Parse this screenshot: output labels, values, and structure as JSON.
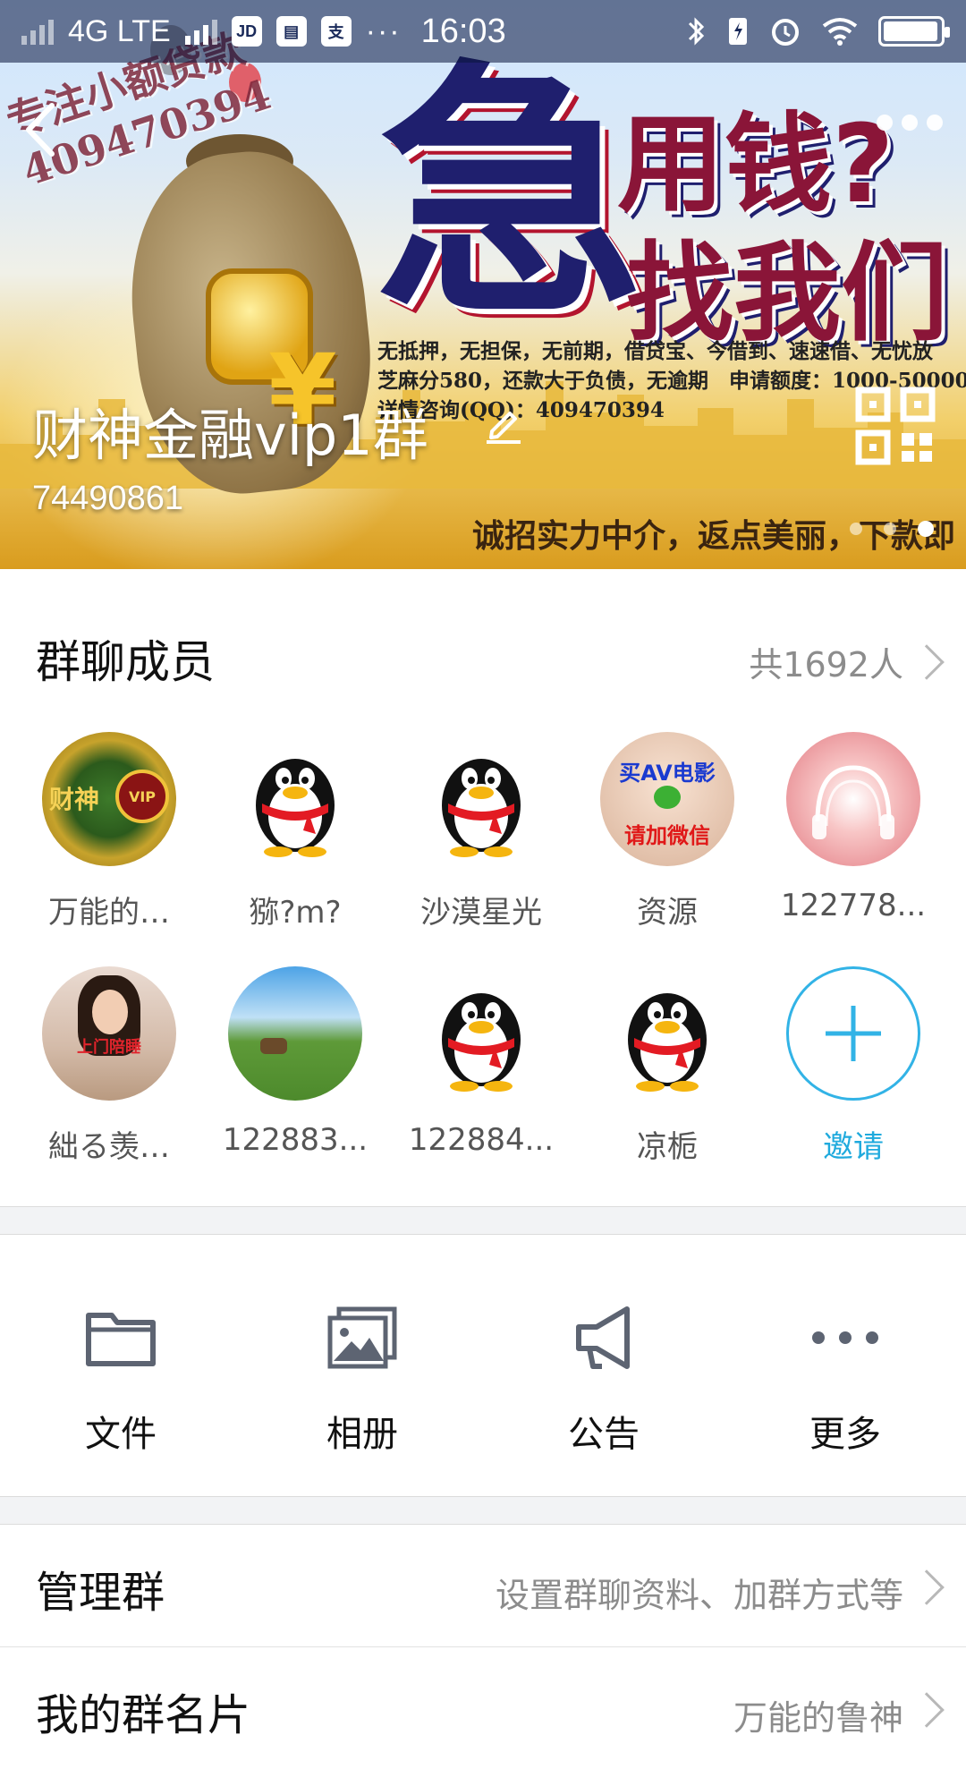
{
  "status_bar": {
    "network": "4G LTE",
    "app_icons": [
      "JD",
      "▤",
      "支"
    ],
    "more": "···",
    "time": "16:03"
  },
  "banner": {
    "watermark": "专注小额贷款 409470394",
    "headline_big": "急",
    "headline_line1": "用钱?",
    "headline_line2": "找我们",
    "copy_line1": "无抵押，无担保，无前期，借贷宝、今借到、速速借、无忧放",
    "copy_line2": "芝麻分580，还款大于负债，无逾期　申请额度：1000-50000",
    "copy_line3": "详情咨询(QQ)：409470394",
    "recruit_text": "诚招实力中介，返点美丽，下款即",
    "carousel_total": 3,
    "carousel_active": 3
  },
  "group": {
    "name": "财神金融vip1群",
    "id": "74490861"
  },
  "members": {
    "title": "群聊成员",
    "count_label": "共1692人",
    "items": [
      {
        "name": "万能的…",
        "avatar": "caishen-vip"
      },
      {
        "name": "猕?m?",
        "avatar": "qq-penguin"
      },
      {
        "name": "沙漠星光",
        "avatar": "qq-penguin"
      },
      {
        "name": "资源",
        "avatar": "ad-image",
        "line1": "买AV电影",
        "line2": "请加微信"
      },
      {
        "name": "122778...",
        "avatar": "pink-headphone"
      },
      {
        "name": "絀る羡…",
        "avatar": "woman-photo",
        "tag": "上门陪睡"
      },
      {
        "name": "122883...",
        "avatar": "field-photo"
      },
      {
        "name": "122884...",
        "avatar": "qq-penguin"
      },
      {
        "name": "凉栀",
        "avatar": "qq-penguin"
      }
    ],
    "invite_label": "邀请"
  },
  "actions": [
    {
      "label": "文件",
      "icon": "folder-icon"
    },
    {
      "label": "相册",
      "icon": "album-icon"
    },
    {
      "label": "公告",
      "icon": "megaphone-icon"
    },
    {
      "label": "更多",
      "icon": "more-dots-icon"
    }
  ],
  "rows": {
    "manage": {
      "title": "管理群",
      "value": "设置群聊资料、加群方式等"
    },
    "card": {
      "title": "我的群名片",
      "value": "万能的鲁神"
    }
  },
  "colors": {
    "accent": "#1faadd",
    "secondary_text": "#8c8c8c",
    "background_band": "#f2f3f5"
  }
}
